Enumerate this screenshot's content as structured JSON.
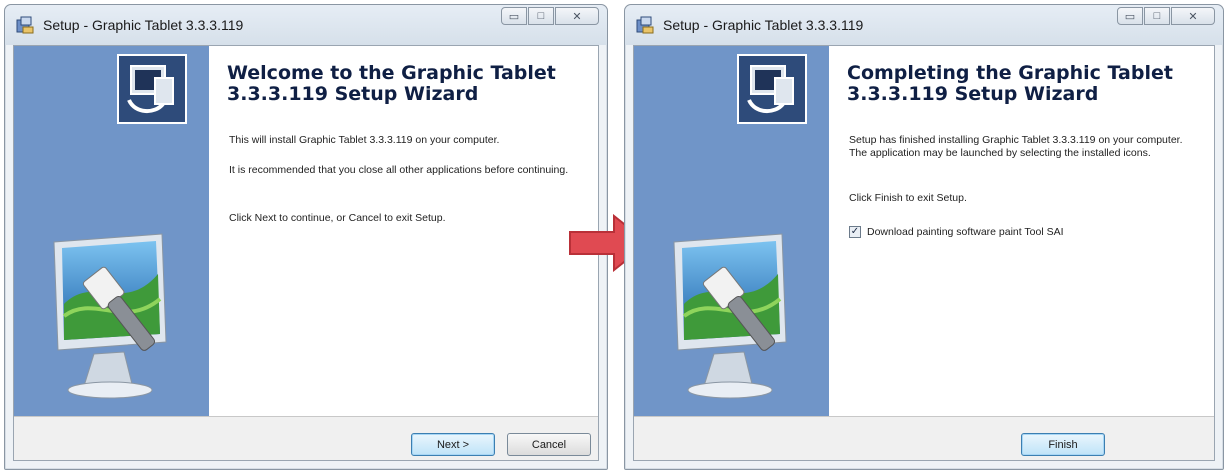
{
  "colors": {
    "side_panel": "#7095c8",
    "heading": "#0f1f44",
    "arrow": "#e04a52"
  },
  "window1": {
    "title": "Setup - Graphic Tablet 3.3.3.119",
    "heading": "Welcome to the Graphic Tablet 3.3.3.119 Setup Wizard",
    "paragraphs": [
      "This will install Graphic Tablet 3.3.3.119 on your computer.",
      "It is recommended that you close all other applications before continuing.",
      "Click Next to continue, or Cancel to exit Setup."
    ],
    "buttons": {
      "next": "Next >",
      "cancel": "Cancel"
    }
  },
  "window2": {
    "title": "Setup - Graphic Tablet 3.3.3.119",
    "heading": "Completing the Graphic Tablet 3.3.3.119 Setup Wizard",
    "paragraphs": [
      "Setup has finished installing Graphic Tablet 3.3.3.119 on your computer. The application may be launched by selecting the installed icons.",
      "Click Finish to exit Setup."
    ],
    "checkbox": {
      "label": "Download painting software paint Tool SAI",
      "checked": true,
      "mark": "✓"
    },
    "buttons": {
      "finish": "Finish"
    }
  },
  "icons": {
    "app": "installer-icon",
    "logo": "computer-install-icon",
    "side_graphic": "monitor-paintbrush-icon",
    "arrow": "right-arrow-icon"
  }
}
